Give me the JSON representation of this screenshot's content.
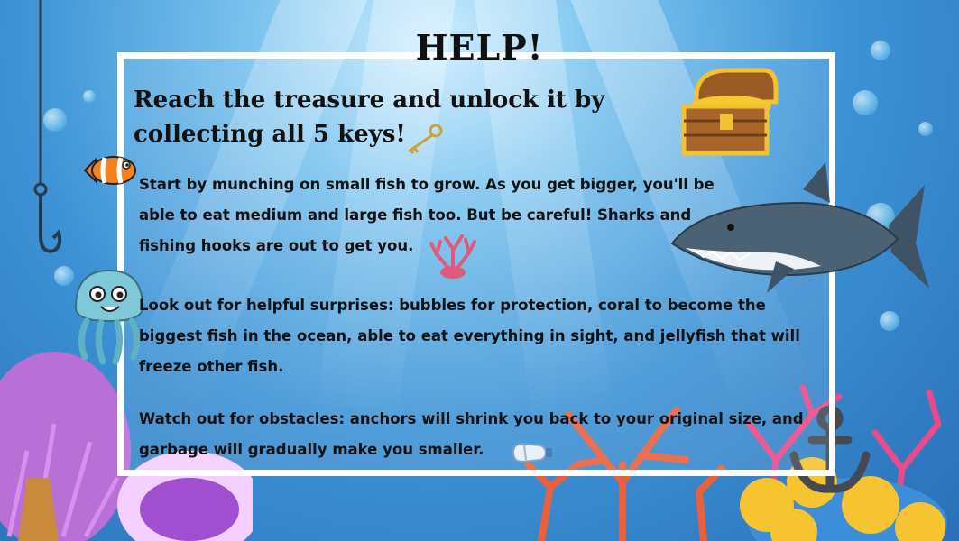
{
  "title": "HELP!",
  "subtitle": "Reach the treasure and unlock it by collecting all 5 keys!",
  "paragraphs": [
    "Start by munching on small fish to grow. As you get bigger, you'll be able to eat medium and large fish too. But be careful! Sharks and fishing hooks are out to get you.",
    "Look out for helpful surprises: bubbles for protection, coral to become the biggest fish in the ocean, able to eat everything in sight, and jellyfish that will freeze other fish.",
    "Watch out for obstacles: anchors will shrink you back to your original size, and garbage will gradually make you smaller."
  ],
  "icons": {
    "key": "key-icon",
    "treasure": "treasure-chest-icon",
    "clownfish": "clownfish-icon",
    "shark": "shark-icon",
    "coral": "coral-icon",
    "jellyfish": "jellyfish-icon",
    "garbage": "garbage-icon",
    "anchor": "anchor-icon",
    "hook": "fishing-hook-icon"
  },
  "colors": {
    "water": "#3d93d6",
    "frame": "#ffffff",
    "text": "#111111"
  }
}
